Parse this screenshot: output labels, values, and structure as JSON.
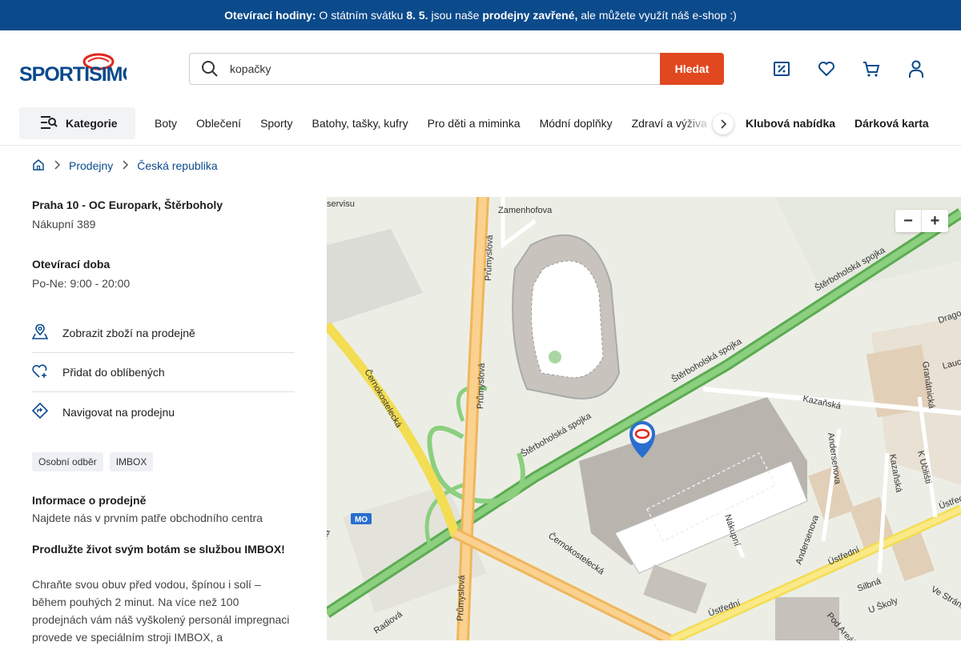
{
  "announcement": {
    "label": "Otevírací hodiny:",
    "text1": "O státním svátku",
    "date": "8. 5.",
    "text2": "jsou naše",
    "closed": "prodejny zavřené,",
    "text3": "ale můžete využít náš e-shop :)"
  },
  "header": {
    "logo_text": "SPORTISIMO",
    "search_value": "kopačky",
    "search_button": "Hledat",
    "icons": [
      "discount-icon",
      "heart-icon",
      "cart-icon",
      "user-icon"
    ]
  },
  "nav": {
    "categories_label": "Kategorie",
    "links": [
      "Boty",
      "Oblečení",
      "Sporty",
      "Batohy, tašky, kufry",
      "Pro děti a miminka",
      "Módní doplňky",
      "Zdraví a výživa"
    ],
    "bold_links": [
      "Klubová nabídka",
      "Dárková karta"
    ]
  },
  "breadcrumb": [
    "Prodejny",
    "Česká republika"
  ],
  "store": {
    "name": "Praha 10 - OC Europark, Štěrboholy",
    "address": "Nákupní 389",
    "hours_title": "Otevírací doba",
    "hours": "Po-Ne: 9:00 - 20:00",
    "actions": [
      "Zobrazit zboží na prodejně",
      "Přidat do oblíbených",
      "Navigovat na prodejnu"
    ],
    "tags": [
      "Osobní odběr",
      "IMBOX"
    ],
    "info_title": "Informace o prodejně",
    "info_text": "Najdete nás v prvním patře obchodního centra",
    "imbox_title": "Prodlužte život svým botám se službou IMBOX!",
    "imbox_text": "Chraňte svou obuv před vodou, špínou i solí – během pouhých 2 minut. Na více než 100 prodejnách vám náš vyškolený personál impregnaci provede ve speciálním stroji IMBOX, a"
  },
  "map": {
    "zoom_out": "−",
    "zoom_in": "+",
    "labels": {
      "servisu": "servisu",
      "zamenhofova": "Zamenhofova",
      "prumyslova1": "Průmyslová",
      "prumyslova2": "Průmyslová",
      "prumyslova3": "Průmyslová",
      "sterbo1": "Štěrboholská spojka",
      "sterbo2": "Štěrboholská spojka",
      "sterbo3": "Štěrboholská spojka",
      "cernokost1": "Černokostelecká",
      "cernokost2": "Černokostelecká",
      "kazanska1": "Kazaňská",
      "kazanska2": "Kazaňská",
      "andersenova1": "Andersenova",
      "andersenova2": "Andersenova",
      "nakupni": "Nákupní",
      "granatnicka": "Granátnická",
      "kucilisti": "K Učilišti",
      "ustredni1": "Ústřední",
      "ustredni2": "Ústřední",
      "ustredni3": "Ústřed",
      "silicna": "Silbná",
      "uskoly": "U Školy",
      "vestrani": "Ve Stráni",
      "podareal": "Pod Areál",
      "radiova": "Radiová",
      "dragoun": "Dragou",
      "laucik": "Lauc",
      "mo": "MO",
      "ka": "ka"
    }
  }
}
